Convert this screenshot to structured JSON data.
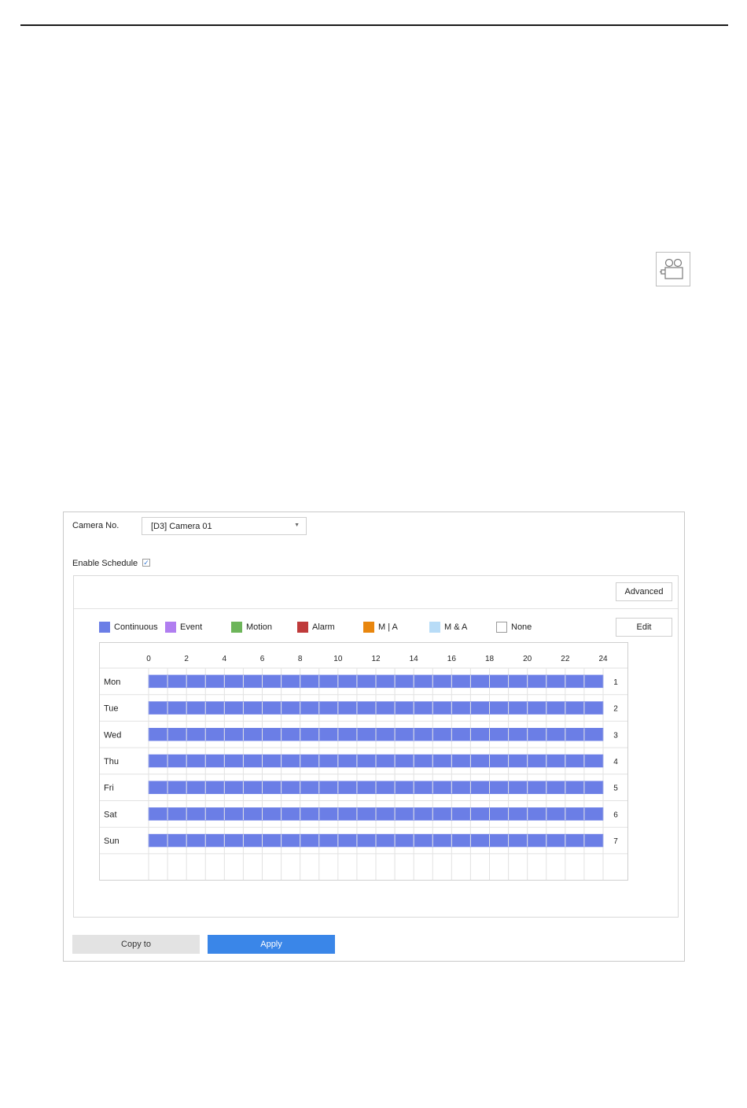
{
  "camera_no": {
    "label": "Camera No.",
    "value": "[D3] Camera 01"
  },
  "enable_schedule": {
    "label": "Enable Schedule",
    "checked": true
  },
  "buttons": {
    "advanced": "Advanced",
    "edit": "Edit",
    "copy_to": "Copy to",
    "apply": "Apply"
  },
  "legend": [
    {
      "label": "Continuous",
      "color": "#6b7ee6"
    },
    {
      "label": "Event",
      "color": "#b07ef0"
    },
    {
      "label": "Motion",
      "color": "#6db55a"
    },
    {
      "label": "Alarm",
      "color": "#bf3a3a"
    },
    {
      "label": "M | A",
      "color": "#e8860e"
    },
    {
      "label": "M & A",
      "color": "#b8dcf7"
    },
    {
      "label": "None",
      "color": "#ffffff"
    }
  ],
  "schedule": {
    "hours": [
      "0",
      "2",
      "4",
      "6",
      "8",
      "10",
      "12",
      "14",
      "16",
      "18",
      "20",
      "22",
      "24"
    ],
    "days": [
      {
        "label": "Mon",
        "num": "1",
        "type": "Continuous",
        "start": 0,
        "end": 24
      },
      {
        "label": "Tue",
        "num": "2",
        "type": "Continuous",
        "start": 0,
        "end": 24
      },
      {
        "label": "Wed",
        "num": "3",
        "type": "Continuous",
        "start": 0,
        "end": 24
      },
      {
        "label": "Thu",
        "num": "4",
        "type": "Continuous",
        "start": 0,
        "end": 24
      },
      {
        "label": "Fri",
        "num": "5",
        "type": "Continuous",
        "start": 0,
        "end": 24
      },
      {
        "label": "Sat",
        "num": "6",
        "type": "Continuous",
        "start": 0,
        "end": 24
      },
      {
        "label": "Sun",
        "num": "7",
        "type": "Continuous",
        "start": 0,
        "end": 24
      }
    ]
  },
  "colors": {
    "continuous": "#6b7ee6",
    "apply": "#3a86e8"
  },
  "icons": {
    "section_icon": "video-camera-icon"
  }
}
